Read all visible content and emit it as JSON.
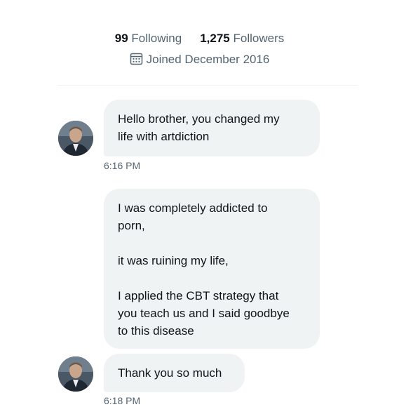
{
  "profile": {
    "following_count": "99",
    "following_label": "Following",
    "followers_count": "1,275",
    "followers_label": "Followers",
    "joined_text": "Joined December 2016",
    "joined_icon": "calendar-icon"
  },
  "messages": [
    {
      "lines": [
        "Hello brother, you changed my",
        "life with artdiction"
      ],
      "time": "6:16 PM"
    },
    {
      "paragraphs": [
        [
          "I was completely addicted to",
          "porn,"
        ],
        [
          "it was ruining my life,"
        ],
        [
          "I applied the CBT strategy that",
          "you teach us and I said goodbye",
          "to this disease"
        ]
      ]
    },
    {
      "lines": [
        "Thank you so much"
      ],
      "time": "6:18 PM"
    }
  ],
  "colors": {
    "bubble_bg": "#eff3f4",
    "text_primary": "#0f1419",
    "text_secondary": "#536471"
  }
}
